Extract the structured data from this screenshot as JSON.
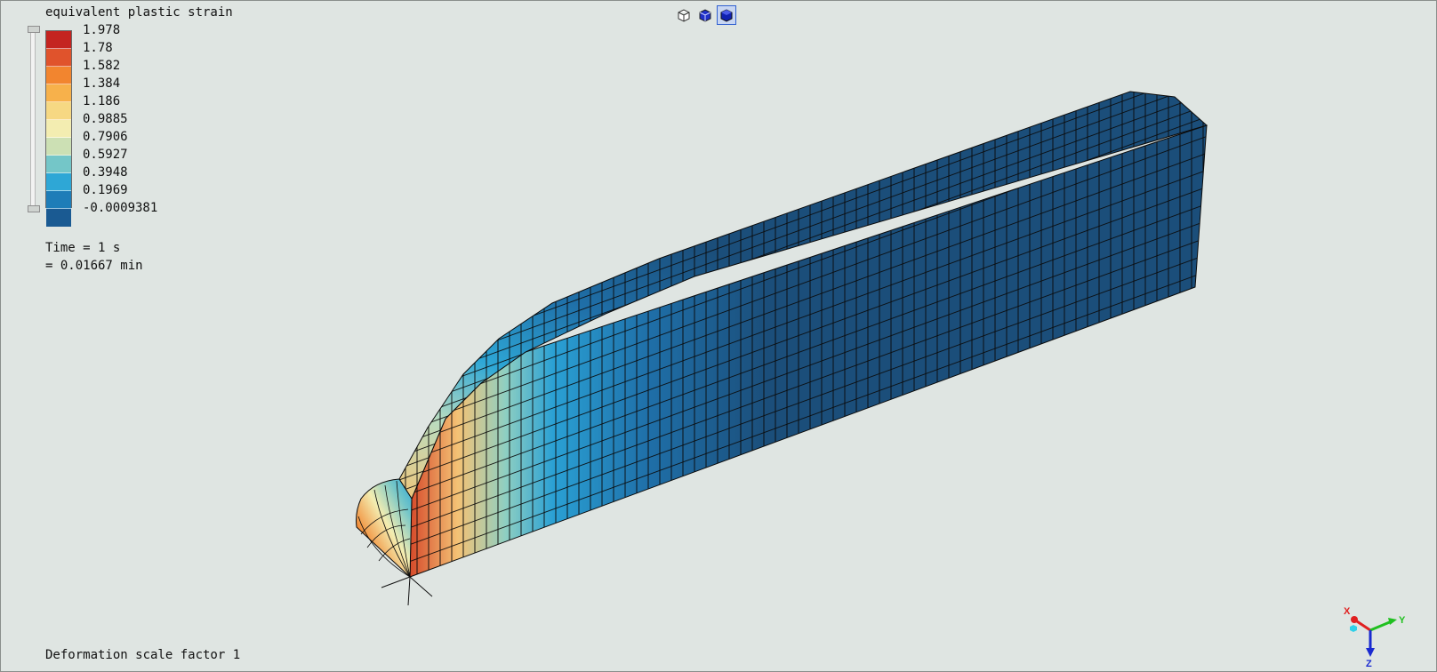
{
  "legend": {
    "title": "equivalent plastic strain",
    "colors": [
      "#c42420",
      "#e0532c",
      "#f2852f",
      "#f7b14b",
      "#f6d883",
      "#f3edb1",
      "#cce0b4",
      "#74c6c8",
      "#2ea7d6",
      "#1e7db8",
      "#1a5a92"
    ],
    "labels": [
      "1.978",
      "1.78",
      "1.582",
      "1.384",
      "1.186",
      "0.9885",
      "0.7906",
      "0.5927",
      "0.3948",
      "0.1969",
      "-0.0009381"
    ],
    "slider_top_fraction": 0.0,
    "slider_bottom_fraction": 1.0
  },
  "time": {
    "line1": "Time = 1 s",
    "line2": "= 0.01667 min"
  },
  "footer": {
    "deformation": "Deformation scale factor 1"
  },
  "toolbar": {
    "buttons": [
      {
        "icon": "wireframe-cube-icon"
      },
      {
        "icon": "hidden-line-cube-icon"
      },
      {
        "icon": "shaded-cube-icon",
        "active": true
      }
    ]
  },
  "triad": {
    "x_label": "X",
    "y_label": "Y",
    "z_label": "Z",
    "x_color": "#e02020",
    "y_color": "#20c020",
    "z_color": "#1a2ad0"
  },
  "model": {
    "mesh_color": "#1b4e7a",
    "edge_color": "#0a0a0a"
  }
}
